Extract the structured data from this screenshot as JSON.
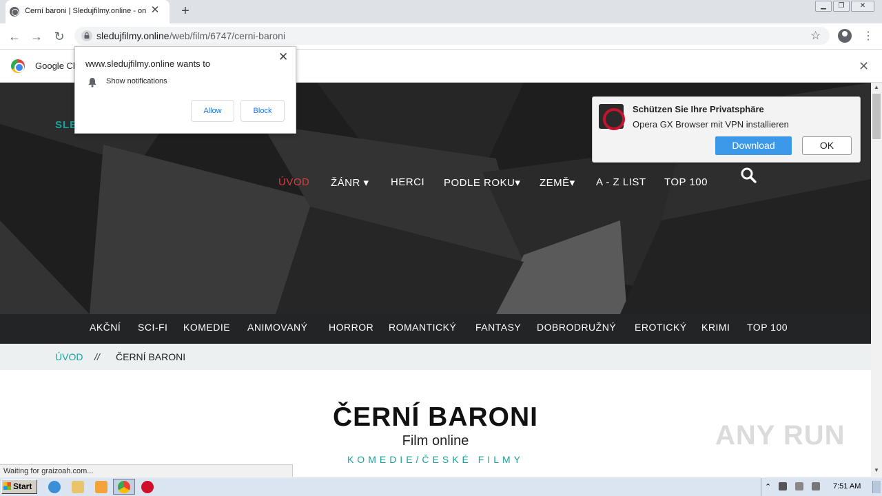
{
  "browser": {
    "tab_title": "Černí baroni | Sledujfilmy.online - online",
    "new_tab": "+",
    "tab_close": "✕",
    "url_host": "sledujfilmy.online",
    "url_path": "/web/film/6747/cerni-baroni",
    "window_controls": [
      "minimize",
      "restore",
      "close"
    ]
  },
  "infobar": {
    "text": "Google Chrome isn't your default browser",
    "close": "✕"
  },
  "notification_prompt": {
    "title": "www.sledujfilmy.online wants to",
    "permission": "Show notifications",
    "allow_label": "Allow",
    "block_label": "Block",
    "close": "✕"
  },
  "opera_popup": {
    "title": "Schützen Sie Ihre Privatsphäre",
    "subtitle": "Opera GX Browser mit VPN installieren",
    "download_label": "Download",
    "ok_label": "OK"
  },
  "site": {
    "logo": "SLE",
    "nav": [
      "ÚVOD",
      "ŽÁNR ▾",
      "HERCI",
      "PODLE ROKU▾",
      "ZEMĚ▾",
      "A - Z LIST",
      "TOP 100"
    ],
    "active_nav_color": "#e03b3b",
    "genres": [
      "AKČNÍ",
      "SCI-FI",
      "KOMEDIE",
      "ANIMOVANÝ",
      "HORROR",
      "ROMANTICKÝ",
      "FANTASY",
      "DOBRODRUŽNÝ",
      "EROTICKÝ",
      "KRIMI",
      "TOP 100"
    ],
    "breadcrumb_home": "ÚVOD",
    "breadcrumb_sep": "//",
    "breadcrumb_current": "ČERNÍ BARONI",
    "film_title": "ČERNÍ BARONI",
    "film_subtitle": "Film online",
    "film_genre": "KOMEDIE/ČESKÉ FILMY",
    "accent_color": "#1aa39b"
  },
  "status_text": "Waiting for graizoah.com...",
  "watermark": "ANY RUN",
  "taskbar": {
    "start_label": "Start",
    "clock": "7:51 AM",
    "apps": [
      "ie-icon",
      "explorer-icon",
      "media-player-icon",
      "chrome-icon",
      "opera-icon"
    ]
  }
}
